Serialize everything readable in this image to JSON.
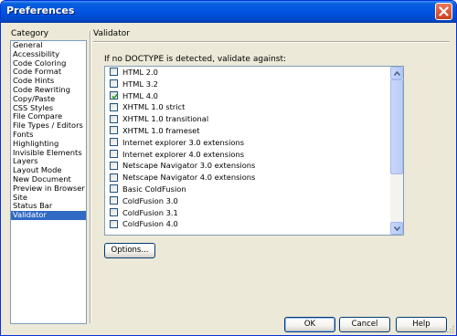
{
  "window": {
    "title": "Preferences"
  },
  "category": {
    "label": "Category",
    "items": [
      "General",
      "Accessibility",
      "Code Coloring",
      "Code Format",
      "Code Hints",
      "Code Rewriting",
      "Copy/Paste",
      "CSS Styles",
      "File Compare",
      "File Types / Editors",
      "Fonts",
      "Highlighting",
      "Invisible Elements",
      "Layers",
      "Layout Mode",
      "New Document",
      "Preview in Browser",
      "Site",
      "Status Bar",
      "Validator"
    ],
    "selected": "Validator"
  },
  "panel": {
    "heading": "Validator",
    "prompt": "If no DOCTYPE is detected, validate against:",
    "options": [
      {
        "label": "HTML 2.0",
        "checked": false
      },
      {
        "label": "HTML 3.2",
        "checked": false
      },
      {
        "label": "HTML 4.0",
        "checked": true
      },
      {
        "label": "XHTML 1.0 strict",
        "checked": false
      },
      {
        "label": "XHTML 1.0 transitional",
        "checked": false
      },
      {
        "label": "XHTML 1.0 frameset",
        "checked": false
      },
      {
        "label": "Internet explorer 3.0 extensions",
        "checked": false
      },
      {
        "label": "Internet explorer 4.0 extensions",
        "checked": false
      },
      {
        "label": "Netscape Navigator 3.0 extensions",
        "checked": false
      },
      {
        "label": "Netscape Navigator 4.0 extensions",
        "checked": false
      },
      {
        "label": "Basic ColdFusion",
        "checked": false
      },
      {
        "label": "ColdFusion 3.0",
        "checked": false
      },
      {
        "label": "ColdFusion 3.1",
        "checked": false
      },
      {
        "label": "ColdFusion 4.0",
        "checked": false
      }
    ],
    "options_button": "Options..."
  },
  "footer": {
    "ok": "OK",
    "cancel": "Cancel",
    "help": "Help"
  },
  "colors": {
    "titlebar": "#0054e3",
    "selection": "#316ac5",
    "dialog": "#ece9d8",
    "check": "#21a121"
  }
}
